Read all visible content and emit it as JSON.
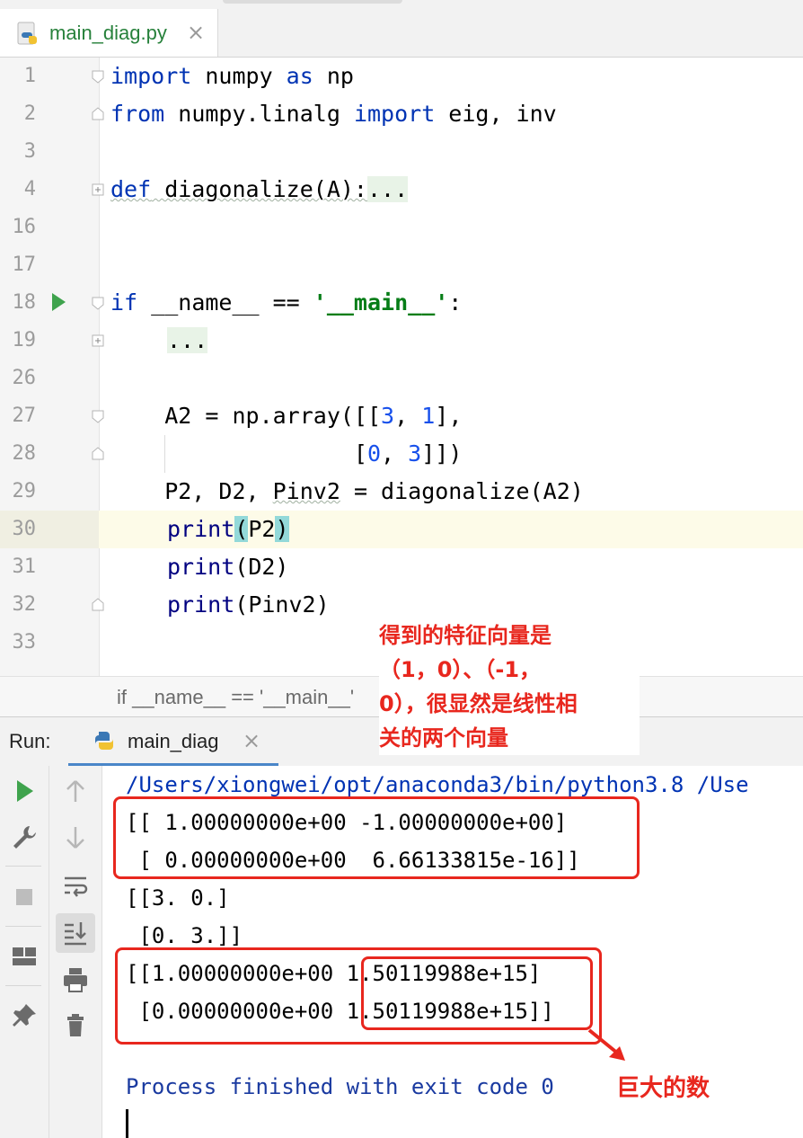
{
  "editor_tab": {
    "label": "main_diag.py",
    "close": "×"
  },
  "code": {
    "line_numbers": [
      "1",
      "2",
      "3",
      "4",
      "16",
      "17",
      "18",
      "19",
      "26",
      "27",
      "28",
      "29",
      "30",
      "31",
      "32",
      "33"
    ],
    "l1": {
      "kw1": "import",
      "rest1": " numpy ",
      "kw2": "as",
      "rest2": " np"
    },
    "l2": {
      "kw1": "from",
      "rest1": " numpy.linalg ",
      "kw2": "import",
      "rest2": " eig, inv"
    },
    "l4": {
      "kw": "def",
      "name": " diagonalize(A):",
      "folded": "..."
    },
    "l18": {
      "kw": "if",
      "rest": " __name__ == ",
      "str": "'__main__'",
      "end": ":"
    },
    "l19": {
      "folded": "..."
    },
    "l27": {
      "pre": "    A2 = np.array([[",
      "n1": "3",
      "mid": ", ",
      "n2": "1",
      "post": "],"
    },
    "l28": {
      "pre": "                  [",
      "n1": "0",
      "mid": ", ",
      "n2": "3",
      "post": "]])"
    },
    "l29": {
      "pre": "    P2, D2, ",
      "sq": "Pinv2",
      "post": " = diagonalize(A2)"
    },
    "l30": {
      "fn": "print",
      "open": "(",
      "arg": "P2",
      "close": ")"
    },
    "l31": {
      "fn": "print",
      "rest": "(D2)"
    },
    "l32": {
      "fn": "print",
      "rest": "(Pinv2)"
    }
  },
  "breadcrumb": {
    "text": "if __name__ == '__main__'"
  },
  "run": {
    "title": "Run:",
    "tab_label": "main_diag",
    "close": "×"
  },
  "console": {
    "cmd": "/Users/xiongwei/opt/anaconda3/bin/python3.8 /Use",
    "out1": "[[ 1.00000000e+00 -1.00000000e+00]",
    "out2": " [ 0.00000000e+00  6.66133815e-16]]",
    "out3": "[[3. 0.]",
    "out4": " [0. 3.]]",
    "out5": "[[1.00000000e+00 1.50119988e+15]",
    "out6": " [0.00000000e+00 1.50119988e+15]]",
    "process": "Process finished with exit code 0"
  },
  "annotations": {
    "note1_lines": [
      "得到的特征向量是",
      "（1，0）、（-1，",
      "0），很显然是线性相",
      "关的两个向量"
    ],
    "note2": "巨大的数"
  },
  "colors": {
    "keyword": "#0033b3",
    "string": "#067d17",
    "number": "#1750eb",
    "run_green": "#3fa34d",
    "annotation_red": "#e8271e",
    "tab_green": "#27813b"
  }
}
